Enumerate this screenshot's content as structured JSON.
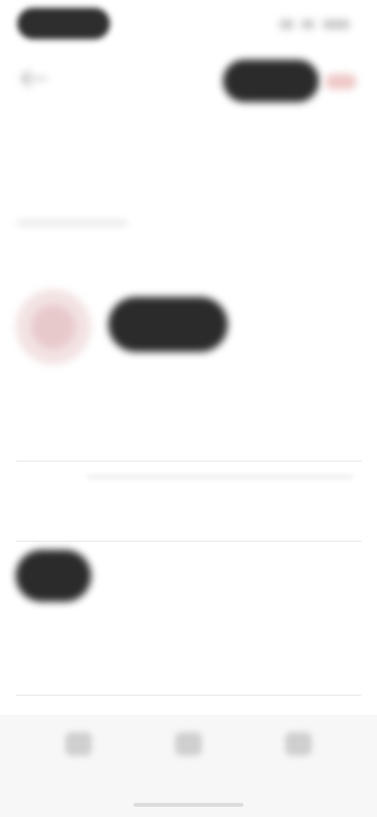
{
  "header": {
    "title": "",
    "action_label": "",
    "extra_label": ""
  },
  "section": {
    "title": "",
    "link": ""
  },
  "tabs": [
    {
      "label": ""
    },
    {
      "label": ""
    },
    {
      "label": ""
    }
  ],
  "profile": {
    "label": "",
    "avatar_button_label": ""
  },
  "fields": [
    {
      "label": "",
      "value": ""
    },
    {
      "label": "",
      "value": ""
    },
    {
      "label": "",
      "value": ""
    }
  ],
  "dark_button_label": "",
  "nav": [
    {
      "icon": "home-icon",
      "label": ""
    },
    {
      "icon": "search-icon",
      "label": ""
    },
    {
      "icon": "profile-icon",
      "label": ""
    }
  ],
  "colors": {
    "accent_dark": "#2b2b2b",
    "accent_pink": "#e8c9cb",
    "background": "#ffffff",
    "nav_background": "#f7f7f7"
  }
}
